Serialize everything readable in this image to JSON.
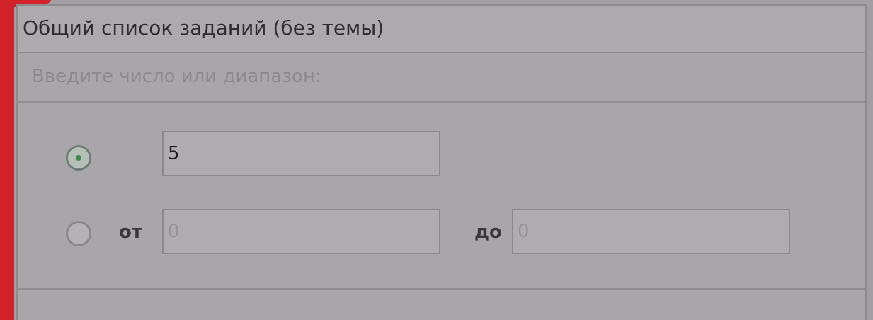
{
  "panel": {
    "title": "Общий список заданий (без темы)",
    "hint": "Введите число или диапазон:"
  },
  "single": {
    "selected": true,
    "value": "5"
  },
  "range": {
    "selected": false,
    "from_label": "от",
    "from_value": "0",
    "to_label": "до",
    "to_value": "0"
  },
  "colors": {
    "accent": "#d2232a",
    "radio_dot": "#3f8a4c"
  }
}
